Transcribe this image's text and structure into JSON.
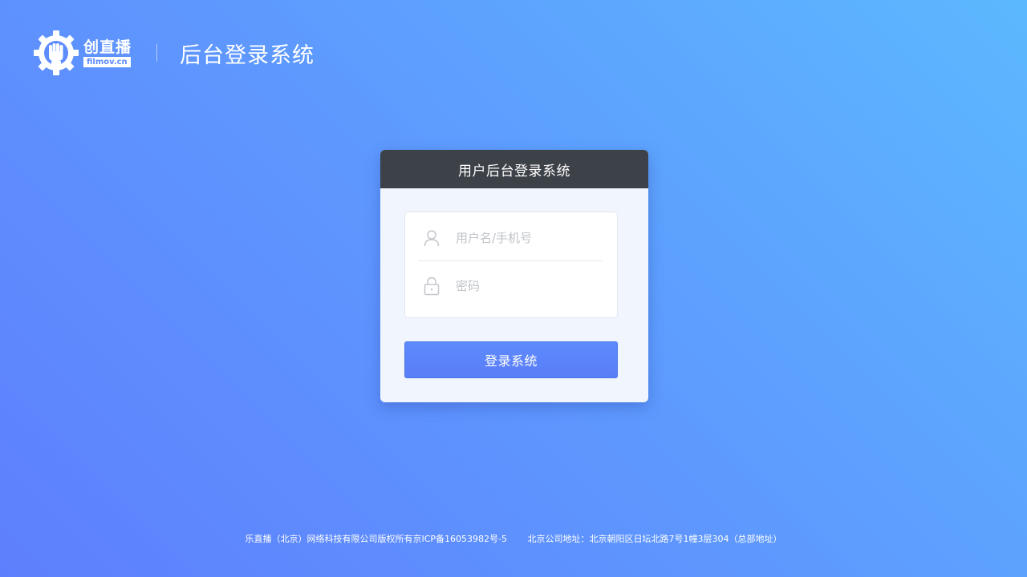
{
  "brand": {
    "logo_cn": "创直播",
    "logo_domain": "filmov.cn",
    "system_title": "后台登录系统",
    "colors": {
      "accent": "#5e8cfd",
      "header_dark": "#3d4148"
    }
  },
  "login": {
    "card_title": "用户后台登录系统",
    "username": {
      "placeholder": "用户名/手机号",
      "value": "",
      "icon": "user-icon"
    },
    "password": {
      "placeholder": "密码",
      "value": "",
      "icon": "lock-icon"
    },
    "submit_label": "登录系统"
  },
  "footer": {
    "copyright": "乐直播（北京）网络科技有限公司版权所有京ICP备16053982号-5",
    "address": "北京公司地址：北京朝阳区日坛北路7号1幢3层304（总部地址）"
  }
}
